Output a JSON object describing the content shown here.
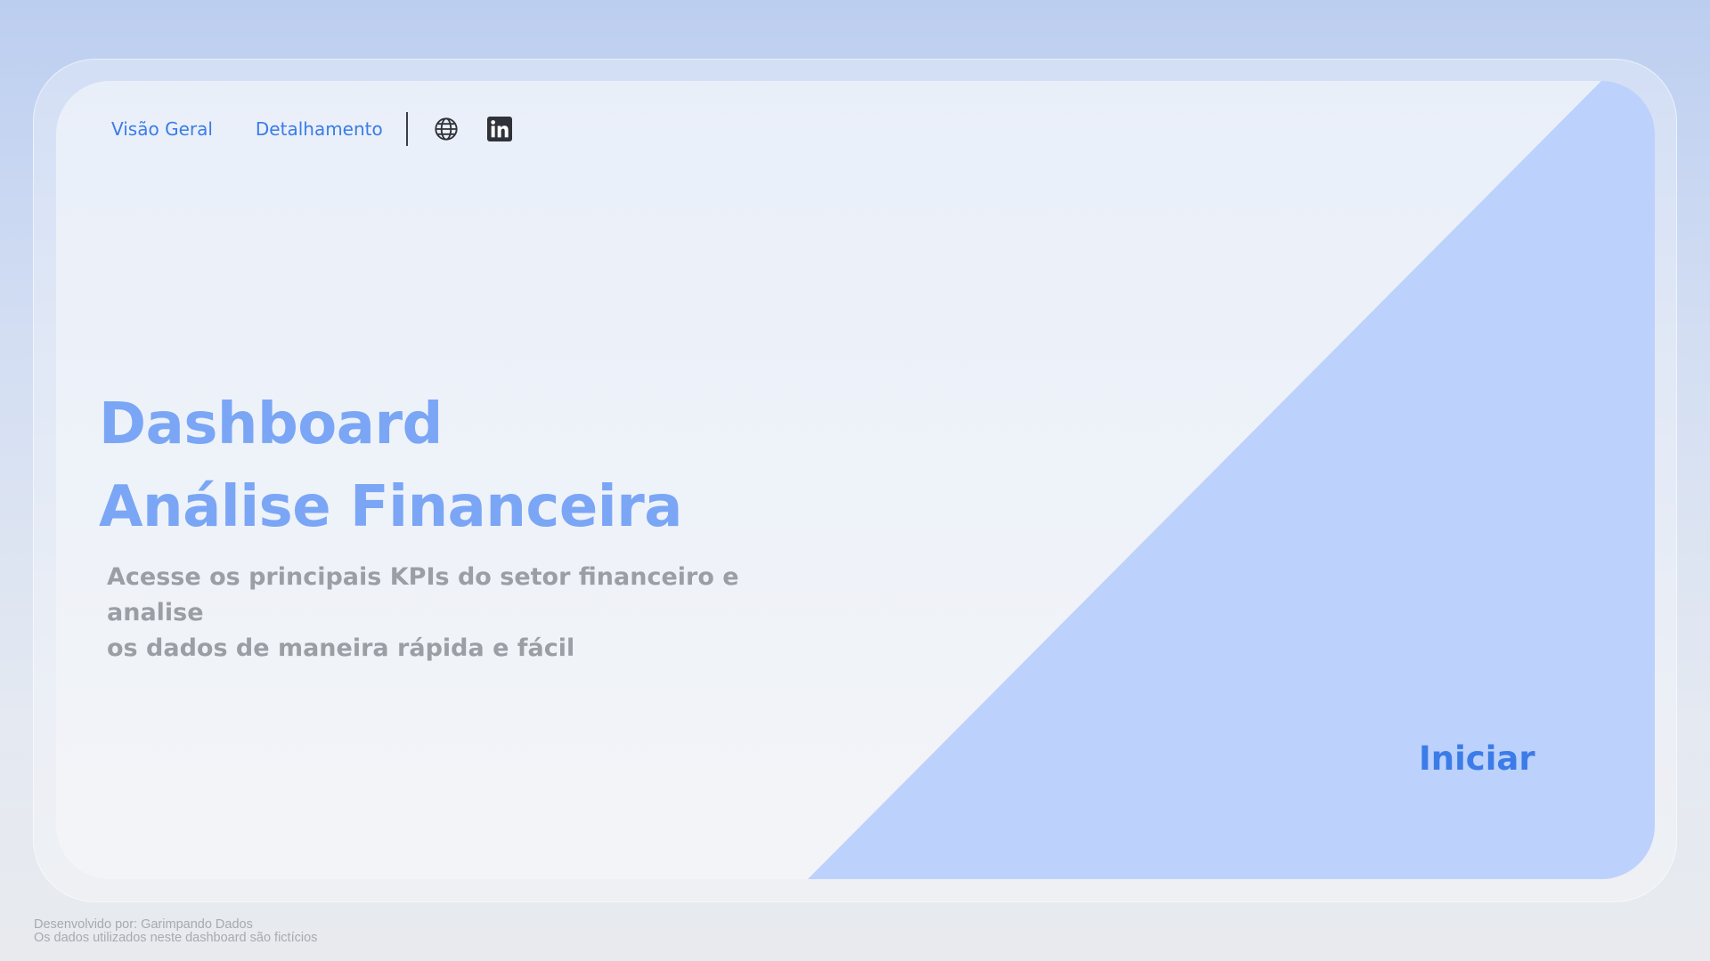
{
  "nav": {
    "items": [
      {
        "label": "Visão Geral"
      },
      {
        "label": "Detalhamento"
      }
    ],
    "icons": [
      "globe-icon",
      "linkedin-icon"
    ]
  },
  "hero": {
    "title_line1": "Dashboard",
    "title_line2": "Análise Financeira",
    "subtitle_line1": "Acesse os principais KPIs do setor financeiro e analise",
    "subtitle_line2": "os dados de maneira rápida e fácil",
    "cta_label": "Iniciar"
  },
  "footer": {
    "line1": "Desenvolvido por: Garimpando Dados",
    "line2": "Os dados utilizados neste dashboard são fictícios"
  },
  "colors": {
    "accent": "#3b7ce8",
    "title": "#7aa6f5",
    "triangle": "#bcd1fc",
    "subtitle": "#9b9ea4"
  }
}
